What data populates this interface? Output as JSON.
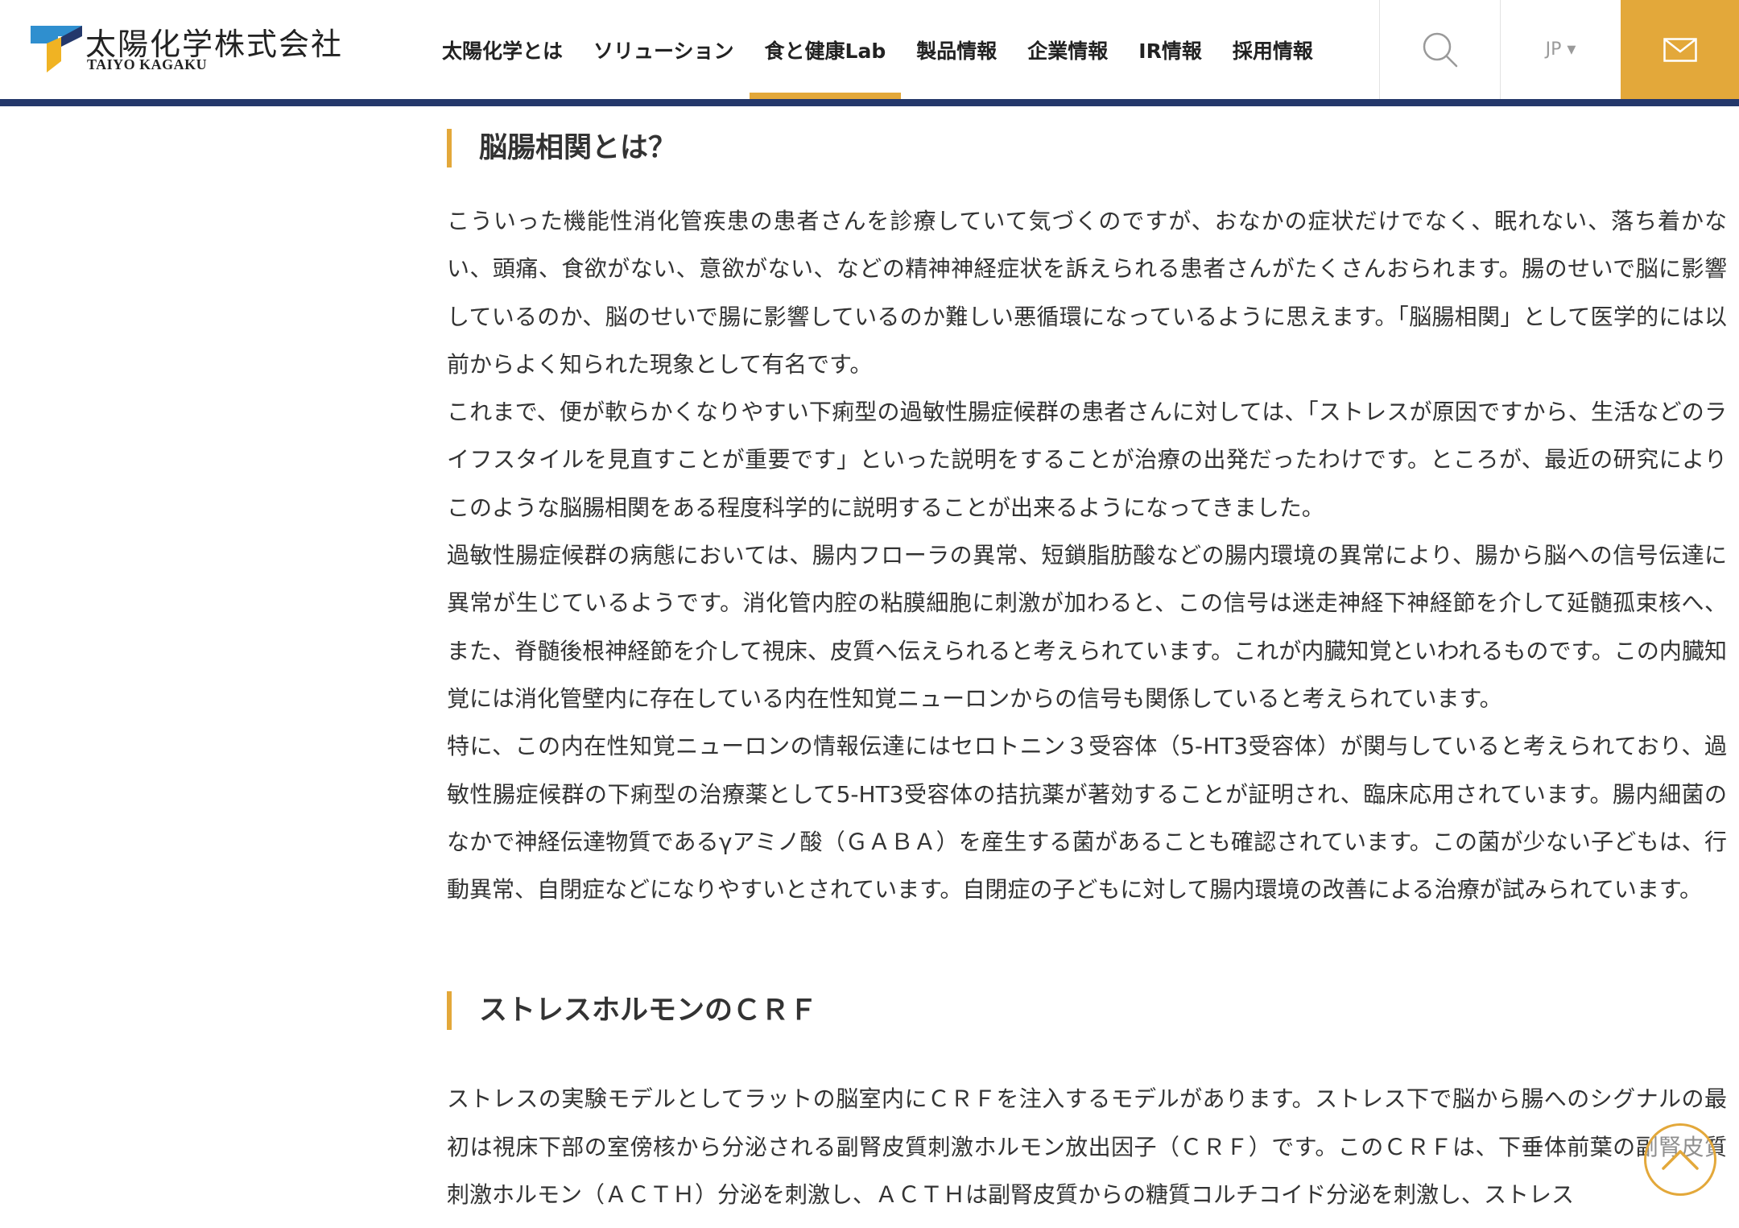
{
  "header": {
    "logo_jp": "太陽化学株式会社",
    "logo_en": "TAIYO KAGAKU",
    "nav": [
      {
        "label": "太陽化学とは"
      },
      {
        "label": "ソリューション"
      },
      {
        "label": "食と健康Lab"
      },
      {
        "label": "製品情報"
      },
      {
        "label": "企業情報"
      },
      {
        "label": "IR情報"
      },
      {
        "label": "採用情報"
      }
    ],
    "active_nav": "食と健康Lab",
    "search_icon": "search-icon",
    "lang": "JP ▾",
    "mail_icon": "mail-icon"
  },
  "sections": [
    {
      "heading": "脳腸相関とは？",
      "paragraphs": [
        "こういった機能性消化管疾患の患者さんを診療していて気づくのですが、おなかの症状だけでなく、眠れない、落ち着かない、頭痛、食欲がない、意欲がない、などの精神神経症状を訴えられる患者さんがたくさんおられます。腸のせいで脳に影響しているのか、脳のせいで腸に影響しているのか難しい悪循環になっているように思えます。「脳腸相関」として医学的には以前からよく知られた現象として有名です。",
        "これまで、便が軟らかくなりやすい下痢型の過敏性腸症候群の患者さんに対しては、「ストレスが原因ですから、生活などのライフスタイルを見直すことが重要です」といった説明をすることが治療の出発だったわけです。ところが、最近の研究によりこのような脳腸相関をある程度科学的に説明することが出来るようになってきました。",
        "過敏性腸症候群の病態においては、腸内フローラの異常、短鎖脂肪酸などの腸内環境の異常により、腸から脳への信号伝達に異常が生じているようです。消化管内腔の粘膜細胞に刺激が加わると、この信号は迷走神経下神経節を介して延髄孤束核へ、また、脊髄後根神経節を介して視床、皮質へ伝えられると考えられています。これが内臓知覚といわれるものです。この内臓知覚には消化管壁内に存在している内在性知覚ニューロンからの信号も関係していると考えられています。",
        "特に、この内在性知覚ニューロンの情報伝達にはセロトニン３受容体（5-HT3受容体）が関与していると考えられており、過敏性腸症候群の下痢型の治療薬として5-HT3受容体の拮抗薬が著効することが証明され、臨床応用されています。腸内細菌のなかで神経伝達物質であるγアミノ酸（ＧＡＢＡ）を産生する菌があることも確認されています。この菌が少ない子どもは、行動異常、自閉症などになりやすいとされています。自閉症の子どもに対して腸内環境の改善による治療が試みられています。"
      ]
    },
    {
      "heading": "ストレスホルモンのＣＲＦ",
      "paragraphs": [
        "ストレスの実験モデルとしてラットの脳室内にＣＲＦを注入するモデルがあります。ストレス下で脳から腸へのシグナルの最初は視床下部の室傍核から分泌される副腎皮質刺激ホルモン放出因子（ＣＲＦ）です。このＣＲＦは、下垂体前葉の副腎皮質刺激ホルモン（ＡＣＴＨ）分泌を刺激し、ＡＣＴＨは副腎皮質からの糖質コルチコイド分泌を刺激し、ストレス"
      ]
    }
  ],
  "pagetop_icon": "chevron-up-icon",
  "colors": {
    "accent": "#e3a83a",
    "navy": "#24386b",
    "text": "#333333",
    "logo_blue": "#2f8fcf",
    "logo_yellow": "#f0b323"
  }
}
